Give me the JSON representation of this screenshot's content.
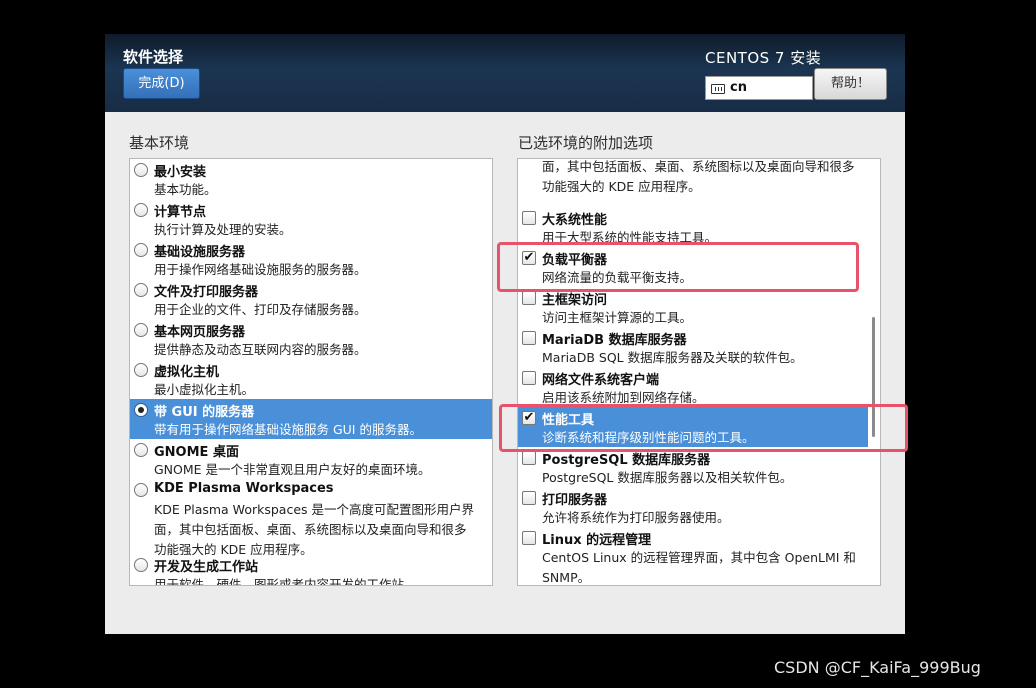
{
  "header": {
    "spoke_title": "软件选择",
    "done_label": "完成(D)",
    "product_title": "CENTOS 7 安装",
    "keyboard_layout": "cn",
    "help_label": "帮助！"
  },
  "base_env": {
    "label": "基本环境",
    "items": [
      {
        "title": "最小安装",
        "desc": "基本功能。",
        "selected": false
      },
      {
        "title": "计算节点",
        "desc": "执行计算及处理的安装。",
        "selected": false
      },
      {
        "title": "基础设施服务器",
        "desc": "用于操作网络基础设施服务的服务器。",
        "selected": false
      },
      {
        "title": "文件及打印服务器",
        "desc": "用于企业的文件、打印及存储服务器。",
        "selected": false
      },
      {
        "title": "基本网页服务器",
        "desc": "提供静态及动态互联网内容的服务器。",
        "selected": false
      },
      {
        "title": "虚拟化主机",
        "desc": "最小虚拟化主机。",
        "selected": false
      },
      {
        "title": "带 GUI 的服务器",
        "desc": "带有用于操作网络基础设施服务 GUI 的服务器。",
        "selected": true
      },
      {
        "title": "GNOME 桌面",
        "desc": "GNOME 是一个非常直观且用户友好的桌面环境。",
        "selected": false
      },
      {
        "title": "KDE Plasma Workspaces",
        "desc": "KDE Plasma Workspaces 是一个高度可配置图形用户界\n面，其中包括面板、桌面、系统图标以及桌面向导和很多\n功能强大的 KDE 应用程序。",
        "selected": false
      },
      {
        "title": "开发及生成工作站",
        "desc": "用于软件、硬件、图形或者内容开发的工作站。",
        "selected": false
      }
    ]
  },
  "addons": {
    "label": "已选环境的附加选项",
    "items": [
      {
        "title": "",
        "desc": "KDE Plasma Workspaces 是一个高度可配置图形用户界\n面，其中包括面板、桌面、系统图标以及桌面向导和很多\n功能强大的 KDE 应用程序。",
        "checked": false,
        "selected": false,
        "partial": true
      },
      {
        "title": "大系统性能",
        "desc": "用于大型系统的性能支持工具。",
        "checked": false,
        "selected": false
      },
      {
        "title": "负载平衡器",
        "desc": "网络流量的负载平衡支持。",
        "checked": true,
        "selected": false
      },
      {
        "title": "主框架访问",
        "desc": "访问主框架计算源的工具。",
        "checked": false,
        "selected": false
      },
      {
        "title": "MariaDB 数据库服务器",
        "desc": "MariaDB SQL 数据库服务器及关联的软件包。",
        "checked": false,
        "selected": false
      },
      {
        "title": "网络文件系统客户端",
        "desc": "启用该系统附加到网络存储。",
        "checked": false,
        "selected": false
      },
      {
        "title": "性能工具",
        "desc": "诊断系统和程序级别性能问题的工具。",
        "checked": true,
        "selected": true
      },
      {
        "title": "PostgreSQL 数据库服务器",
        "desc": "PostgreSQL 数据库服务器以及相关软件包。",
        "checked": false,
        "selected": false
      },
      {
        "title": "打印服务器",
        "desc": "允许将系统作为打印服务器使用。",
        "checked": false,
        "selected": false
      },
      {
        "title": "Linux 的远程管理",
        "desc": "CentOS Linux 的远程管理界面，其中包含 OpenLMI 和\nSNMP。",
        "checked": false,
        "selected": false
      }
    ]
  },
  "watermark": "CSDN @CF_KaiFa_999Bug",
  "colors": {
    "selection": "#4a90d9",
    "highlight_box": "#e8526a",
    "header": "#1b3552"
  }
}
